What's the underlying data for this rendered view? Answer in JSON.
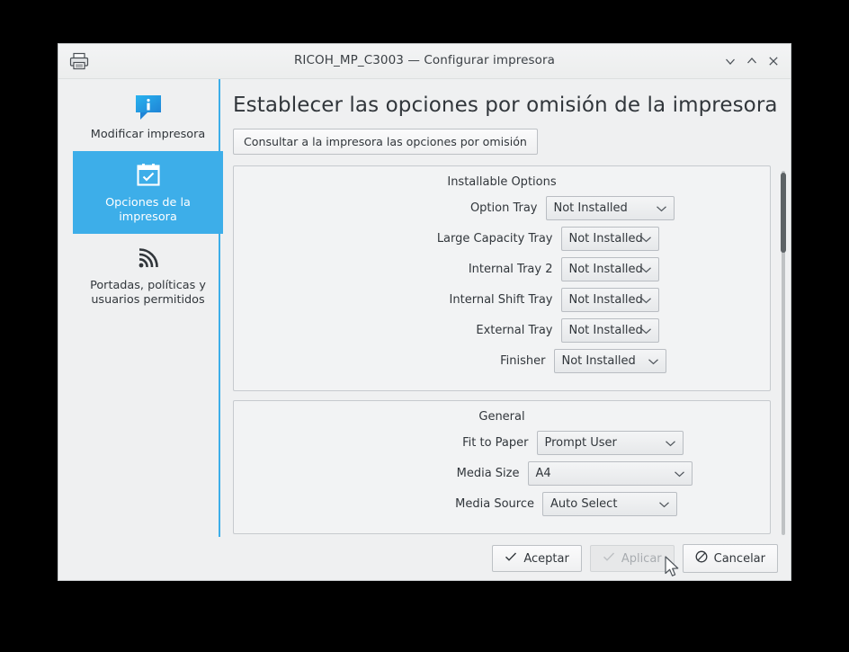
{
  "window": {
    "title": "RICOH_MP_C3003 — Configurar impresora",
    "icon": "printer-icon",
    "controls": [
      {
        "name": "minimize-button",
        "icon": "chevron-down-icon"
      },
      {
        "name": "maximize-button",
        "icon": "chevron-up-icon"
      },
      {
        "name": "close-button",
        "icon": "close-icon"
      }
    ]
  },
  "sidebar": {
    "items": [
      {
        "label": "Modificar impresora",
        "icon": "info-bubble-icon",
        "selected": false
      },
      {
        "label": "Opciones de la impresora",
        "icon": "clipboard-check-icon",
        "selected": true
      },
      {
        "label": "Portadas, políticas y usuarios permitidos",
        "icon": "signal-waves-icon",
        "selected": false
      }
    ]
  },
  "content": {
    "page_title": "Establecer las opciones por omisión de la impresora",
    "query_button": "Consultar a la impresora las opciones por omisión",
    "groups": [
      {
        "title": "Installable Options",
        "rows": [
          {
            "label": "Option Tray",
            "value": "Not Installed",
            "width": 143
          },
          {
            "label": "Large Capacity Tray",
            "value": "Not Installed",
            "width": 109
          },
          {
            "label": "Internal Tray 2",
            "value": "Not Installed",
            "width": 109
          },
          {
            "label": "Internal Shift Tray",
            "value": "Not Installed",
            "width": 109
          },
          {
            "label": "External Tray",
            "value": "Not Installed",
            "width": 109
          },
          {
            "label": "Finisher",
            "value": "Not Installed",
            "width": 125
          }
        ]
      },
      {
        "title": "General",
        "rows": [
          {
            "label": "Fit to Paper",
            "value": "Prompt User",
            "width": 163
          },
          {
            "label": "Media Size",
            "value": "A4",
            "width": 183
          },
          {
            "label": "Media Source",
            "value": "Auto Select",
            "width": 150
          }
        ]
      }
    ]
  },
  "buttons": {
    "accept": {
      "label": "Aceptar",
      "icon": "check-icon",
      "enabled": true
    },
    "apply": {
      "label": "Aplicar",
      "icon": "check-icon",
      "enabled": false
    },
    "cancel": {
      "label": "Cancelar",
      "icon": "prohibition-icon",
      "enabled": true
    }
  },
  "colors": {
    "accent": "#3daee9",
    "window_bg": "#eff0f1",
    "text": "#31363b"
  }
}
